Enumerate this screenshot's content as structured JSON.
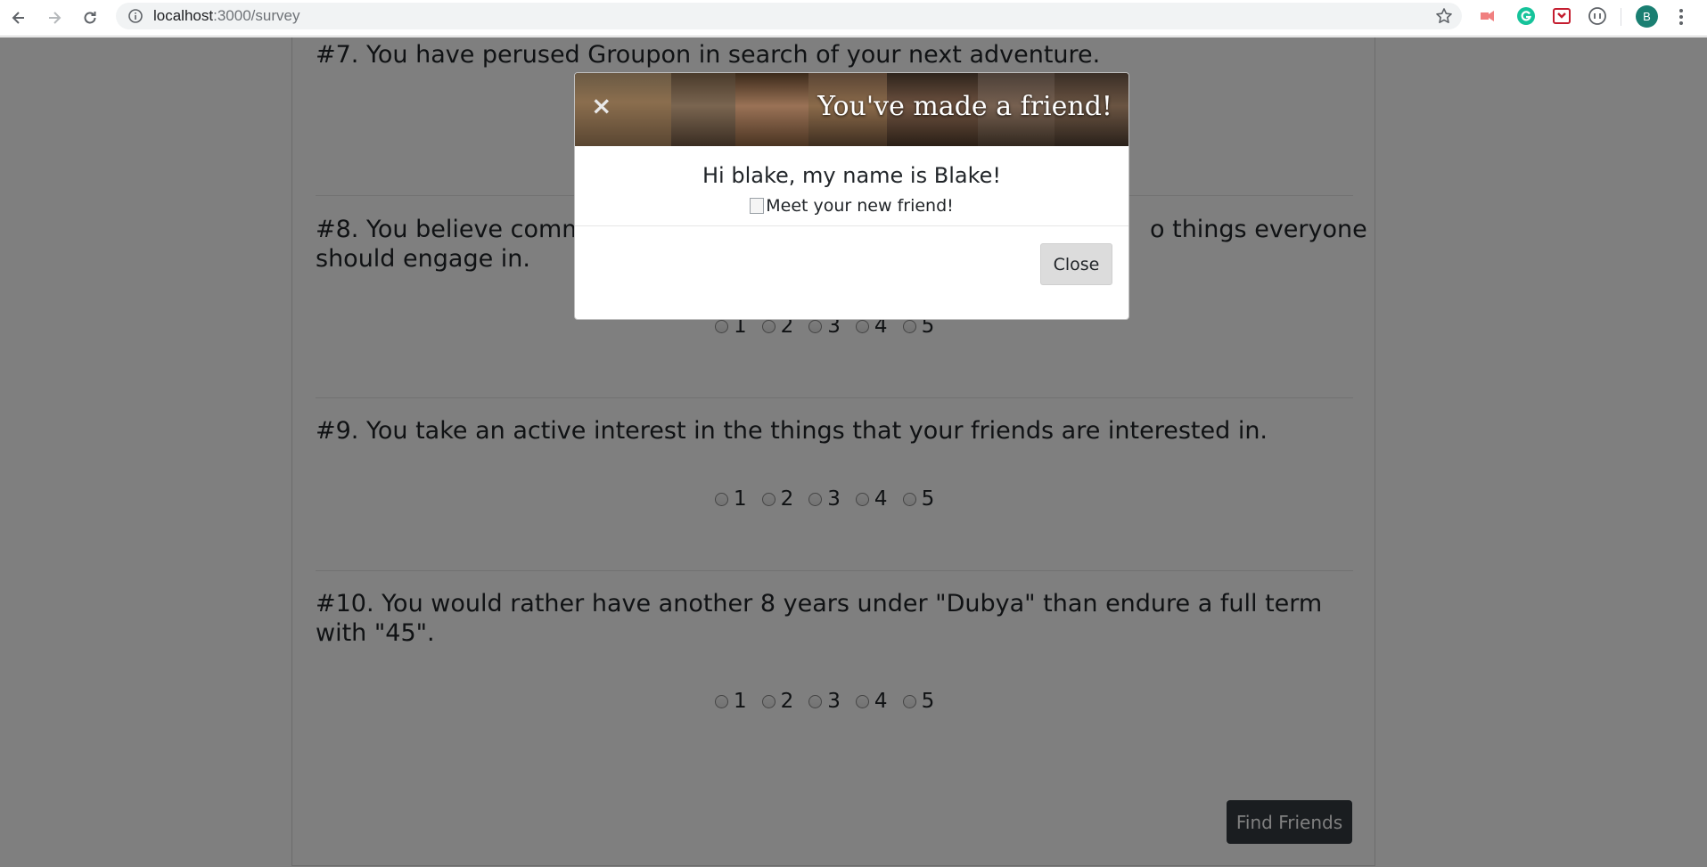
{
  "browser": {
    "url_host": "localhost",
    "url_path": ":3000/survey",
    "profile_initial": "B"
  },
  "survey": {
    "questions": [
      {
        "text": "#7. You have perused Groupon in search of your next adventure."
      },
      {
        "text": "#8. You believe comm... things everyone should engage in.",
        "line1": "#8. You believe comm",
        "line1_tail": "o things everyone",
        "line2": "should engage in."
      },
      {
        "text": "#9. You take an active interest in the things that your friends are interested in."
      },
      {
        "text": "#10. You would rather have another 8 years under \"Dubya\" than endure a full term with \"45\".",
        "line1": "#10. You would rather have another 8 years under \"Dubya\" than endure a full term",
        "line2": "with \"45\"."
      }
    ],
    "options": [
      "1",
      "2",
      "3",
      "4",
      "5"
    ],
    "submit_label": "Find Friends"
  },
  "modal": {
    "close_x": "×",
    "title": "You've made a friend!",
    "greeting": "Hi blake, my name is Blake!",
    "image_alt": "Meet your new friend!",
    "close_label": "Close"
  },
  "colors": {
    "overlay": "rgba(0,0,0,0.5)",
    "submit_bg": "#343a40",
    "avatar_bg": "#1a7f72",
    "grammarly": "#15c39a"
  }
}
